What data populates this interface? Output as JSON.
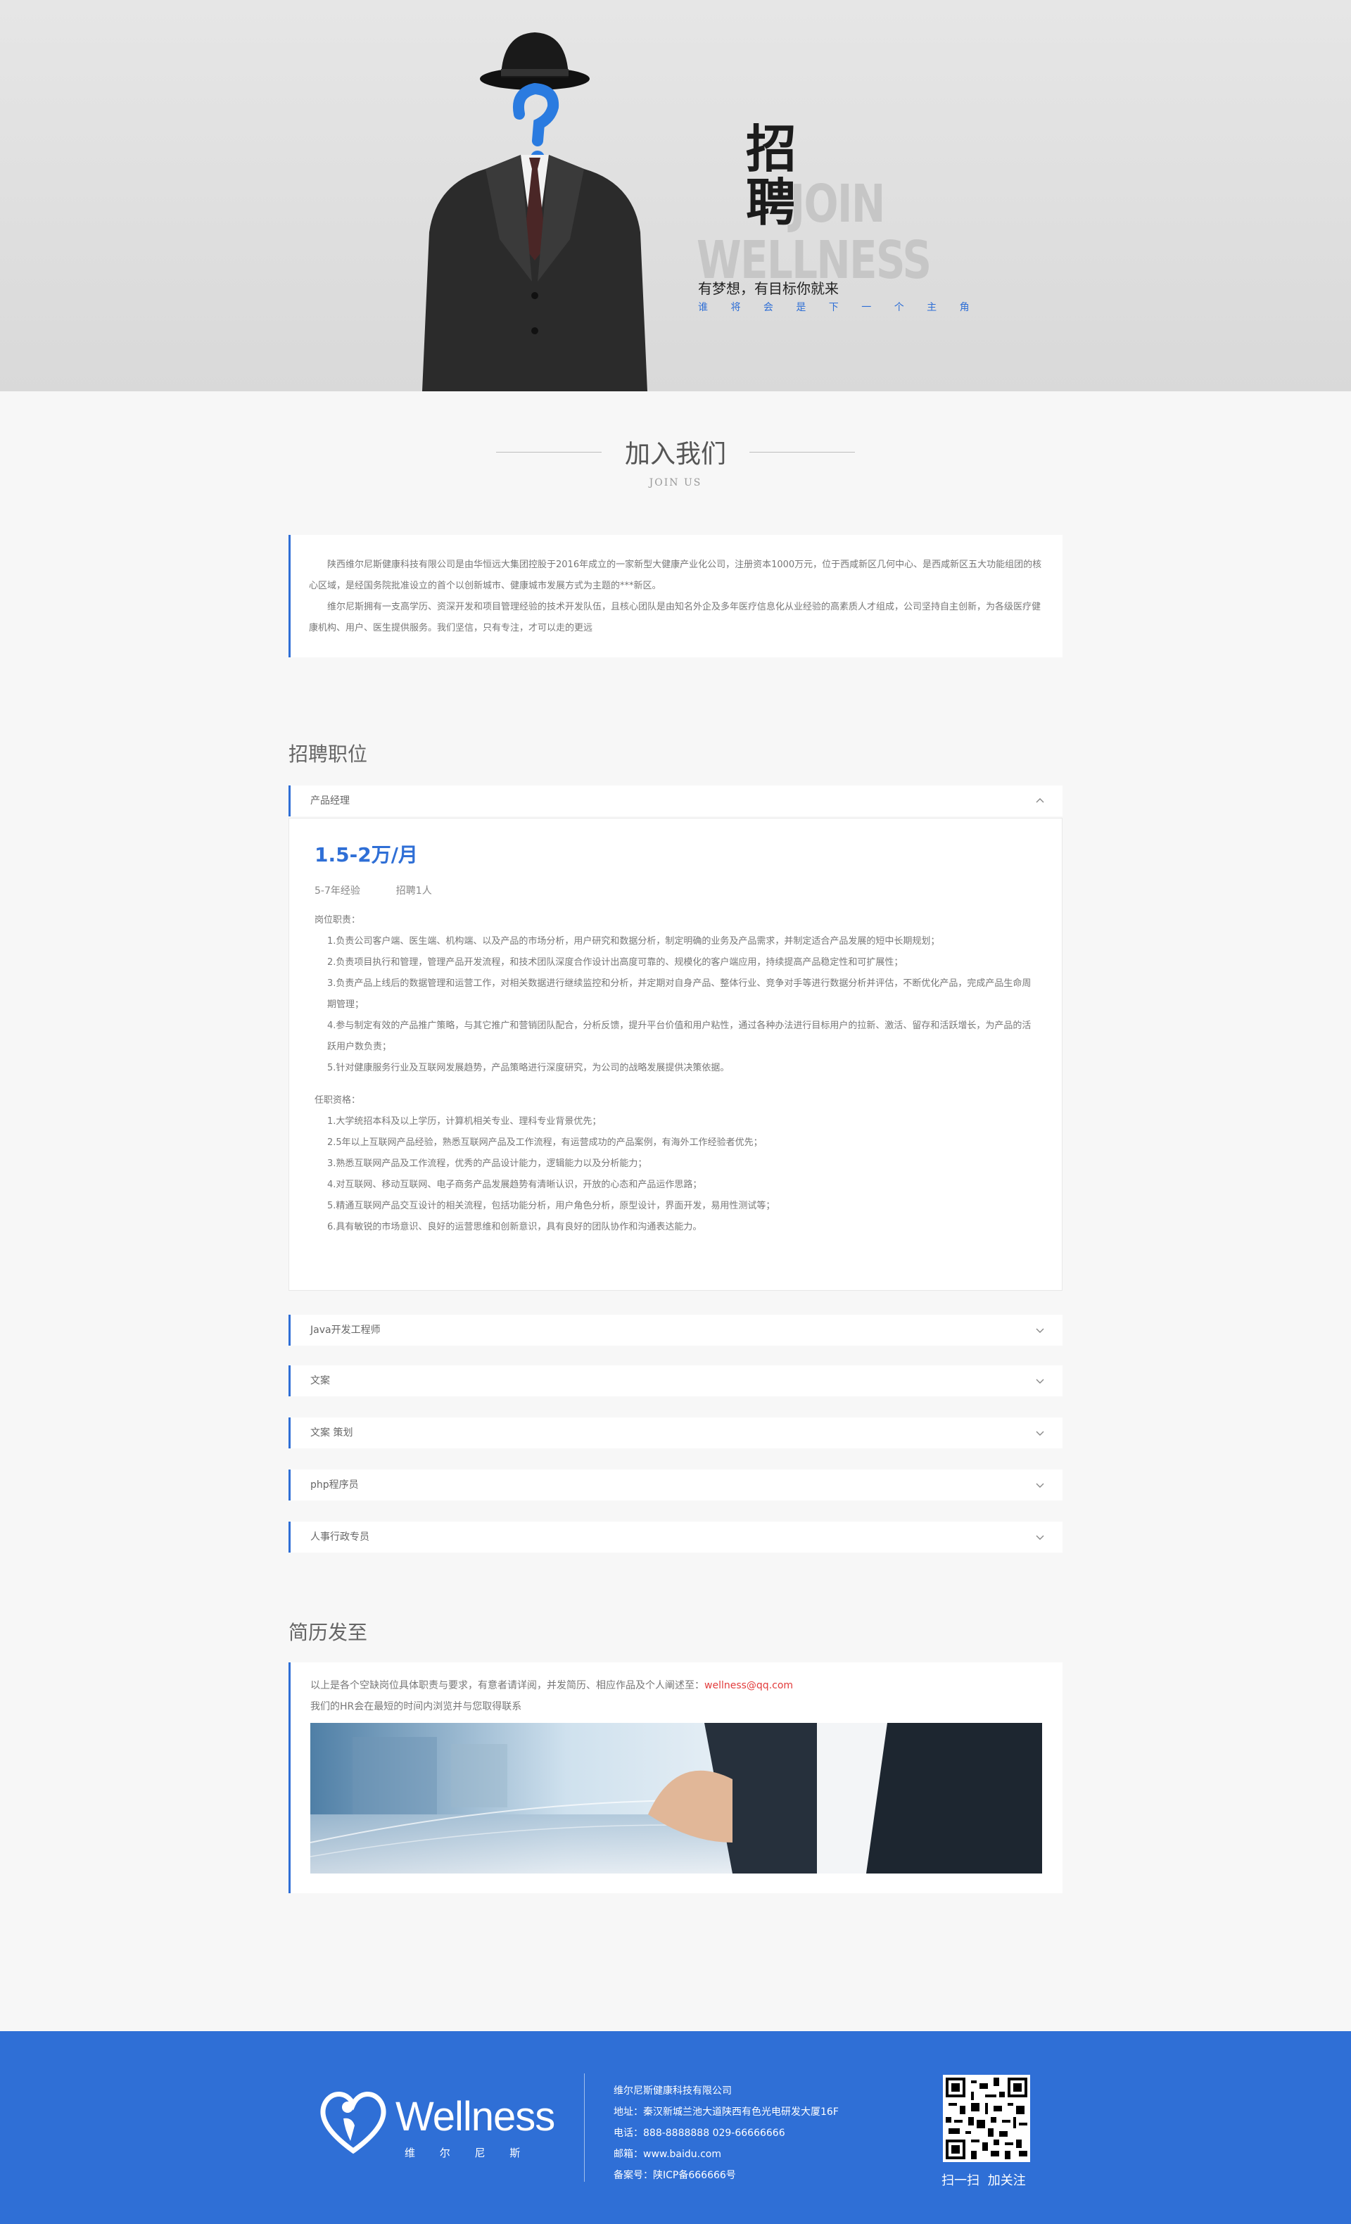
{
  "hero": {
    "char1": "招",
    "char2": "聘",
    "join_word1": "JOIN",
    "join_word2": "WELLNESS",
    "tagline": "有梦想，有目标你就来",
    "subtag": "谁 将 会 是 下 一 个 主 角"
  },
  "section": {
    "title_cn": "加入我们",
    "title_en": "JOIN US"
  },
  "intro": {
    "p1": "陕西维尔尼斯健康科技有限公司是由华恒远大集团控股于2016年成立的一家新型大健康产业化公司，注册资本1000万元，位于西咸新区几何中心、是西咸新区五大功能组团的核心区域，是经国务院批准设立的首个以创新城市、健康城市发展方式为主题的***新区。",
    "p2": "维尔尼斯拥有一支高学历、资深开发和项目管理经验的技术开发队伍，且核心团队是由知名外企及多年医疗信息化从业经验的高素质人才组成，公司坚持自主创新，为各级医疗健康机构、用户、医生提供服务。我们坚信，只有专注，才可以走的更远"
  },
  "positions": {
    "heading": "招聘职位",
    "open": {
      "name": "产品经理",
      "salary": "1.5-2万/月",
      "experience": "5-7年经验",
      "headcount": "招聘1人",
      "duties_title": "岗位职责：",
      "duties": [
        "1.负责公司客户端、医生端、机构端、以及产品的市场分析，用户研究和数据分析，制定明确的业务及产品需求，并制定适合产品发展的短中长期规划；",
        "2.负责项目执行和管理，管理产品开发流程，和技术团队深度合作设计出高度可靠的、规模化的客户端应用，持续提高产品稳定性和可扩展性；",
        "3.负责产品上线后的数据管理和运营工作，对相关数据进行继续监控和分析，并定期对自身产品、整体行业、竞争对手等进行数据分析并评估，不断优化产品，完成产品生命周期管理；",
        "4.参与制定有效的产品推广策略，与其它推广和营销团队配合，分析反馈，提升平台价值和用户粘性，通过各种办法进行目标用户的拉新、激活、留存和活跃增长，为产品的活跃用户数负责；",
        "5.针对健康服务行业及互联网发展趋势，产品策略进行深度研究，为公司的战略发展提供决策依据。"
      ],
      "req_title": "任职资格：",
      "requirements": [
        "1.大学统招本科及以上学历，计算机相关专业、理科专业背景优先；",
        "2.5年以上互联网产品经验，熟悉互联网产品及工作流程，有运营成功的产品案例，有海外工作经验者优先；",
        "3.熟悉互联网产品及工作流程，优秀的产品设计能力，逻辑能力以及分析能力；",
        "4.对互联网、移动互联网、电子商务产品发展趋势有清晰认识，开放的心态和产品运作思路；",
        "5.精通互联网产品交互设计的相关流程，包括功能分析，用户角色分析，原型设计，界面开发，易用性测试等；",
        "6.具有敏锐的市场意识、良好的运营思维和创新意识，具有良好的团队协作和沟通表达能力。"
      ]
    },
    "collapsed": [
      "Java开发工程师",
      "文案",
      "文案 策划",
      "php程序员",
      "人事行政专员"
    ]
  },
  "resume": {
    "heading": "简历发至",
    "line1": "以上是各个空缺岗位具体职责与要求，有意者请详阅，并发简历、相应作品及个人阐述至：",
    "email": "wellness@qq.com",
    "line2": "我们的HR会在最短的时间内浏览并与您取得联系"
  },
  "footer": {
    "logo": "Wellness",
    "logo_sub": "维 尔 尼 斯",
    "company": "维尔尼斯健康科技有限公司",
    "address": "地址：秦汉新城兰池大道陕西有色光电研发大厦16F",
    "phone": "电话：888-8888888    029-66666666",
    "email": "邮箱：www.baidu.com",
    "icp": "备案号：陕ICP备666666号",
    "qr_caption": "扫一扫 加关注"
  },
  "colors": {
    "accent": "#2f6fd6",
    "footer_bg": "#2f6fd6",
    "email": "#e23c3c"
  }
}
